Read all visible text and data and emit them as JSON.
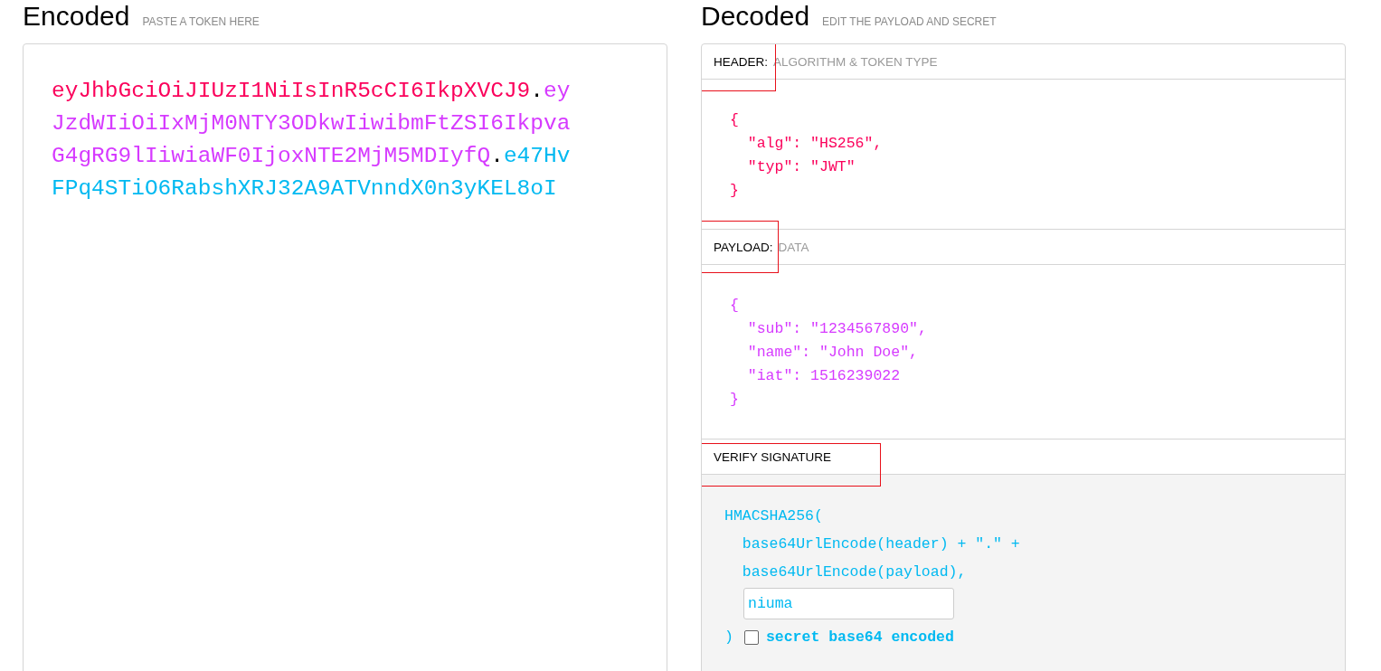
{
  "encoded": {
    "title": "Encoded",
    "hint": "PASTE A TOKEN HERE",
    "token": [
      {
        "kind": "header",
        "text": "eyJhbGciOiJIUzI1NiIsInR5cCI6IkpXVCJ9"
      },
      {
        "kind": "dot",
        "text": "."
      },
      {
        "kind": "payload",
        "text": "eyJzdWIiOiIxMjM0NTY3ODkwIiwibmFtZSI6IkpvaG4gRG9lIiwiaWF0IjoxNTE2MjM5MDIyfQ"
      },
      {
        "kind": "dot",
        "text": "."
      },
      {
        "kind": "signature",
        "text": "e47HvFPq4STiO6RabshXRJ32A9ATVnndX0n3yKEL8oI"
      }
    ]
  },
  "decoded": {
    "title": "Decoded",
    "hint": "EDIT THE PAYLOAD AND SECRET",
    "sections": [
      {
        "kind": "header",
        "label": "HEADER:",
        "hint": "ALGORITHM & TOKEN TYPE",
        "highlighted": true,
        "lines": [
          "{",
          "  \"alg\": \"HS256\",",
          "  \"typ\": \"JWT\"",
          "}"
        ]
      },
      {
        "kind": "payload",
        "label": "PAYLOAD:",
        "hint": "DATA",
        "highlighted": true,
        "lines": [
          "{",
          "  \"sub\": \"1234567890\",",
          "  \"name\": \"John Doe\",",
          "  \"iat\": 1516239022",
          "}"
        ]
      },
      {
        "kind": "signature",
        "label": "VERIFY SIGNATURE",
        "highlighted": true,
        "lines": [
          "HMACSHA256(",
          "  base64UrlEncode(header) + \".\" +",
          "  base64UrlEncode(payload),"
        ],
        "secret": "niuma",
        "close": ")",
        "checkbox": {
          "label": "secret base64 encoded",
          "checked": false
        }
      }
    ]
  }
}
